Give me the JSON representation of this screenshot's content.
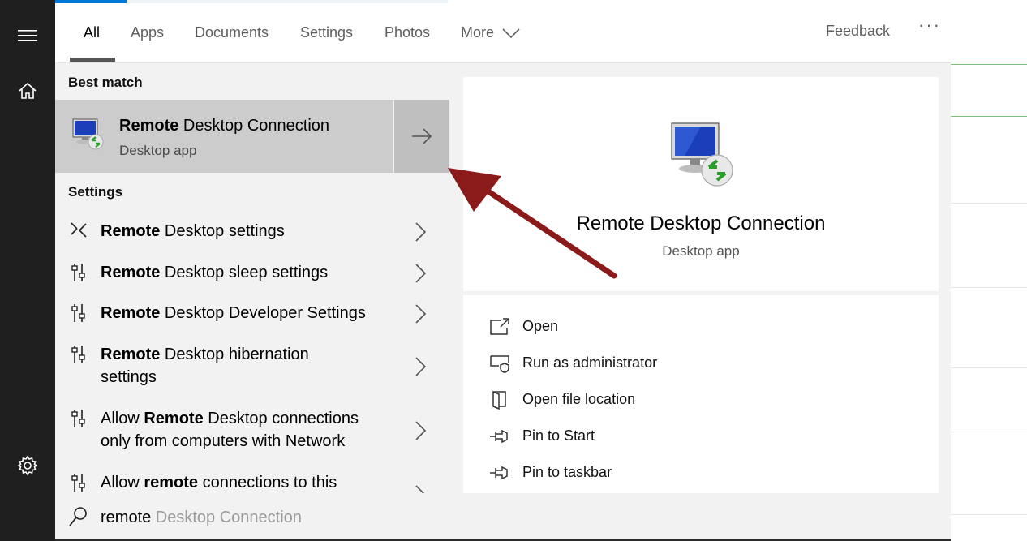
{
  "tabs": [
    {
      "label": "All",
      "active": true
    },
    {
      "label": "Apps"
    },
    {
      "label": "Documents"
    },
    {
      "label": "Settings"
    },
    {
      "label": "Photos"
    },
    {
      "label": "More"
    }
  ],
  "header": {
    "feedback": "Feedback",
    "more_dots": "···"
  },
  "best_match": {
    "heading": "Best match",
    "title_bold": "Remote",
    "title_rest": " Desktop Connection",
    "subtitle": "Desktop app"
  },
  "settings": {
    "heading": "Settings",
    "items": [
      {
        "pre": "",
        "bold": "Remote",
        "post": " Desktop settings",
        "icon": "remote-desktop-settings-icon"
      },
      {
        "pre": "",
        "bold": "Remote",
        "post": " Desktop sleep settings",
        "icon": "settings-sliders-icon"
      },
      {
        "pre": "",
        "bold": "Remote",
        "post": " Desktop Developer Settings",
        "icon": "settings-sliders-icon"
      },
      {
        "pre": "",
        "bold": "Remote",
        "post": " Desktop hibernation settings",
        "icon": "settings-sliders-icon"
      },
      {
        "pre": "Allow ",
        "bold": "Remote",
        "post": " Desktop connections only from computers with Network",
        "icon": "settings-sliders-icon"
      },
      {
        "pre": "Allow ",
        "bold": "remote",
        "post": " connections to this",
        "icon": "settings-sliders-icon"
      }
    ]
  },
  "detail": {
    "title": "Remote Desktop Connection",
    "subtitle": "Desktop app",
    "actions": [
      {
        "label": "Open",
        "icon": "open-icon"
      },
      {
        "label": "Run as administrator",
        "icon": "shield-icon"
      },
      {
        "label": "Open file location",
        "icon": "file-location-icon"
      },
      {
        "label": "Pin to Start",
        "icon": "pin-icon"
      },
      {
        "label": "Pin to taskbar",
        "icon": "pin-icon"
      }
    ]
  },
  "search": {
    "typed": "remote",
    "hint": " Desktop Connection"
  },
  "colors": {
    "accent": "#0078d7",
    "selected": "#cccccc",
    "annotation_arrow": "#8b1a1a",
    "rail": "#1f1f1f"
  }
}
